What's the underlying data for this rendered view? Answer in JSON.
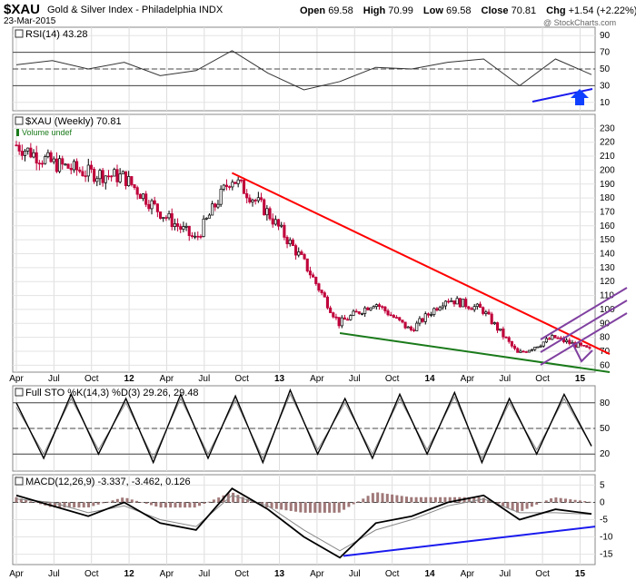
{
  "header": {
    "symbol": "$XAU",
    "name": "Gold & Silver Index - Philadelphia INDX",
    "date": "23-Mar-2015",
    "open_label": "Open",
    "open": "69.58",
    "high_label": "High",
    "high": "70.99",
    "low_label": "Low",
    "low": "69.58",
    "close_label": "Close",
    "close": "70.81",
    "chg_label": "Chg",
    "chg": "+1.54 (+2.22%)",
    "watermark": "@ StockCharts.com"
  },
  "colors": {
    "up": "#000000",
    "down": "#c0003a",
    "resistance": "#ff0000",
    "support": "#1a7a1a",
    "channel": "#8040a0",
    "divergence": "#1a1aee",
    "arrow": "#1040ff",
    "macd_hist": "#a07878"
  },
  "chart_data": [
    {
      "type": "line",
      "panel": "RSI",
      "title": "RSI(14) 43.28",
      "y_ticks": [
        10,
        30,
        50,
        70,
        90
      ],
      "ylim": [
        0,
        100
      ],
      "reference_lines": [
        30,
        70
      ],
      "series": [
        {
          "name": "RSI(14)",
          "x": [
            "Apr 2011",
            "Jul 2011",
            "Oct 2011",
            "Jan 2012",
            "Apr 2012",
            "Jul 2012",
            "Oct 2012",
            "Jan 2013",
            "Apr 2013",
            "Jul 2013",
            "Oct 2013",
            "Jan 2014",
            "Apr 2014",
            "Jul 2014",
            "Oct 2014",
            "Jan 2015",
            "Mar 2015"
          ],
          "values": [
            55,
            60,
            50,
            58,
            42,
            48,
            72,
            45,
            25,
            35,
            52,
            50,
            58,
            62,
            30,
            62,
            43.28
          ]
        }
      ]
    },
    {
      "type": "line",
      "panel": "Price",
      "title": "$XAU (Weekly) 70.81",
      "legend": [
        "Volume undef"
      ],
      "ylim": [
        55,
        240
      ],
      "y_ticks": [
        60,
        70,
        80,
        90,
        100,
        110,
        120,
        130,
        140,
        150,
        160,
        170,
        180,
        190,
        200,
        210,
        220,
        230
      ],
      "x_ticks": [
        "Apr",
        "Jul",
        "Oct",
        "12",
        "Apr",
        "Jul",
        "Oct",
        "13",
        "Apr",
        "Jul",
        "Oct",
        "14",
        "Apr",
        "Jul",
        "Oct",
        "15"
      ],
      "x": [
        "Apr 2011",
        "Jul 2011",
        "Oct 2011",
        "Jan 2012",
        "Apr 2012",
        "Jul 2012",
        "Oct 2012",
        "Jan 2013",
        "Apr 2013",
        "Jul 2013",
        "Oct 2013",
        "Jan 2014",
        "Apr 2014",
        "Jul 2014",
        "Oct 2014",
        "Jan 2015",
        "Mar 2015"
      ],
      "values": [
        218,
        205,
        198,
        195,
        170,
        150,
        195,
        170,
        135,
        90,
        105,
        85,
        108,
        100,
        68,
        80,
        70.81
      ],
      "trendlines": [
        {
          "name": "resistance",
          "from": [
            "Oct 2012",
            198
          ],
          "to": [
            "Mar 2015",
            68
          ]
        },
        {
          "name": "support",
          "from": [
            "Jul 2013",
            83
          ],
          "to": [
            "Mar 2015",
            55
          ]
        }
      ]
    },
    {
      "type": "line",
      "panel": "STO",
      "title": "Full STO %K(14,3) %D(3) 29.26, 29.48",
      "y_ticks": [
        20,
        50,
        80
      ],
      "ylim": [
        0,
        100
      ],
      "series": [
        {
          "name": "%K",
          "values": [
            80,
            15,
            90,
            20,
            85,
            10,
            90,
            15,
            88,
            10,
            95,
            20,
            85,
            15,
            90,
            20,
            92,
            10,
            85,
            20,
            90,
            29.26
          ]
        },
        {
          "name": "%D",
          "values": [
            75,
            20,
            85,
            25,
            80,
            15,
            85,
            20,
            83,
            15,
            90,
            25,
            80,
            20,
            85,
            25,
            87,
            15,
            80,
            25,
            85,
            29.48
          ]
        }
      ]
    },
    {
      "type": "bar",
      "panel": "MACD",
      "title": "MACD(12,26,9) -3.337, -3.462, 0.126",
      "y_ticks": [
        -15,
        -10,
        -5,
        0,
        5
      ],
      "ylim": [
        -18,
        8
      ],
      "x_ticks": [
        "Apr",
        "Jul",
        "Oct",
        "12",
        "Apr",
        "Jul",
        "Oct",
        "13",
        "Apr",
        "Jul",
        "Oct",
        "14",
        "Apr",
        "Jul",
        "Oct",
        "15"
      ],
      "series": [
        {
          "name": "MACD",
          "values": [
            2,
            -1,
            -4,
            0,
            -6,
            -8,
            4,
            -2,
            -10,
            -16,
            -6,
            -4,
            0,
            2,
            -5,
            -2,
            -3.337
          ]
        },
        {
          "name": "Signal",
          "values": [
            1,
            0,
            -3,
            -1,
            -5,
            -7,
            2,
            -1,
            -8,
            -14,
            -8,
            -5,
            -1,
            1,
            -3,
            -3,
            -3.462
          ]
        },
        {
          "name": "Histogram",
          "values": [
            1,
            -1,
            -1,
            1,
            -1,
            -1,
            2,
            -1,
            -2,
            -2,
            2,
            1,
            1,
            1,
            -2,
            1,
            0.126
          ]
        }
      ]
    }
  ]
}
